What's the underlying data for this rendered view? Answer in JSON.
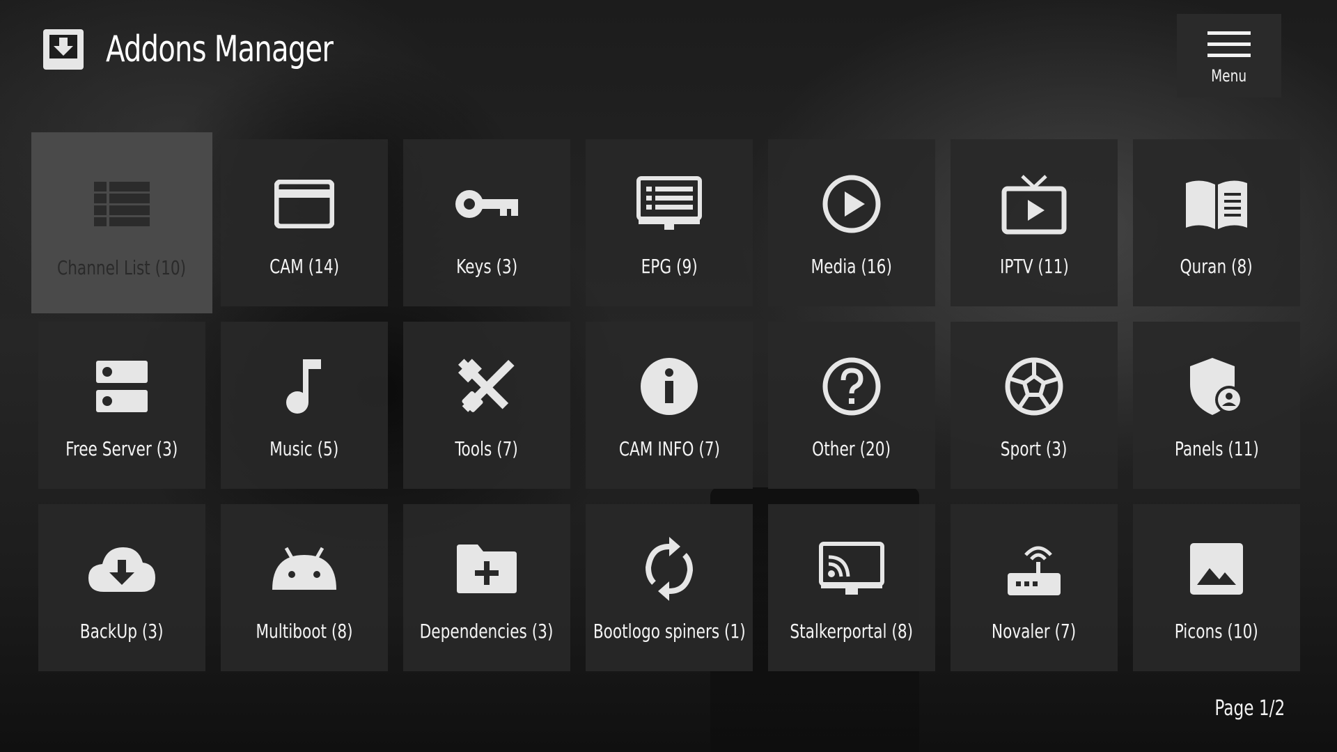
{
  "header": {
    "title": "Addons Manager",
    "icon": "download-box-icon"
  },
  "menu": {
    "label": "Menu",
    "icon": "hamburger-icon"
  },
  "tiles": [
    {
      "label": "Channel List (10)",
      "icon": "list-icon",
      "selected": true
    },
    {
      "label": "CAM (14)",
      "icon": "card-icon"
    },
    {
      "label": "Keys (3)",
      "icon": "key-icon"
    },
    {
      "label": "EPG (9)",
      "icon": "epg-monitor-icon"
    },
    {
      "label": "Media (16)",
      "icon": "play-circle-icon"
    },
    {
      "label": "IPTV (11)",
      "icon": "tv-play-icon"
    },
    {
      "label": "Quran (8)",
      "icon": "open-book-icon"
    },
    {
      "label": "Free Server (3)",
      "icon": "server-icon"
    },
    {
      "label": "Music (5)",
      "icon": "music-note-icon"
    },
    {
      "label": "Tools (7)",
      "icon": "tools-icon"
    },
    {
      "label": "CAM INFO (7)",
      "icon": "info-icon"
    },
    {
      "label": "Other (20)",
      "icon": "help-circle-icon"
    },
    {
      "label": "Sport (3)",
      "icon": "soccer-ball-icon"
    },
    {
      "label": "Panels (11)",
      "icon": "shield-user-icon"
    },
    {
      "label": "BackUp (3)",
      "icon": "cloud-download-icon"
    },
    {
      "label": "Multiboot (8)",
      "icon": "android-icon"
    },
    {
      "label": "Dependencies (3)",
      "icon": "folder-plus-icon"
    },
    {
      "label": "Bootlogo spiners (1)",
      "icon": "sync-icon"
    },
    {
      "label": "Stalkerportal (8)",
      "icon": "cast-icon"
    },
    {
      "label": "Novaler (7)",
      "icon": "router-icon"
    },
    {
      "label": "Picons (10)",
      "icon": "image-icon"
    }
  ],
  "footer": {
    "page_indicator": "Page 1/2"
  },
  "colors": {
    "tile_bg": "#282828",
    "tile_selected_bg": "#4a4a4a",
    "icon": "#e6e6e6",
    "selected_icon": "#2b2b2b"
  }
}
